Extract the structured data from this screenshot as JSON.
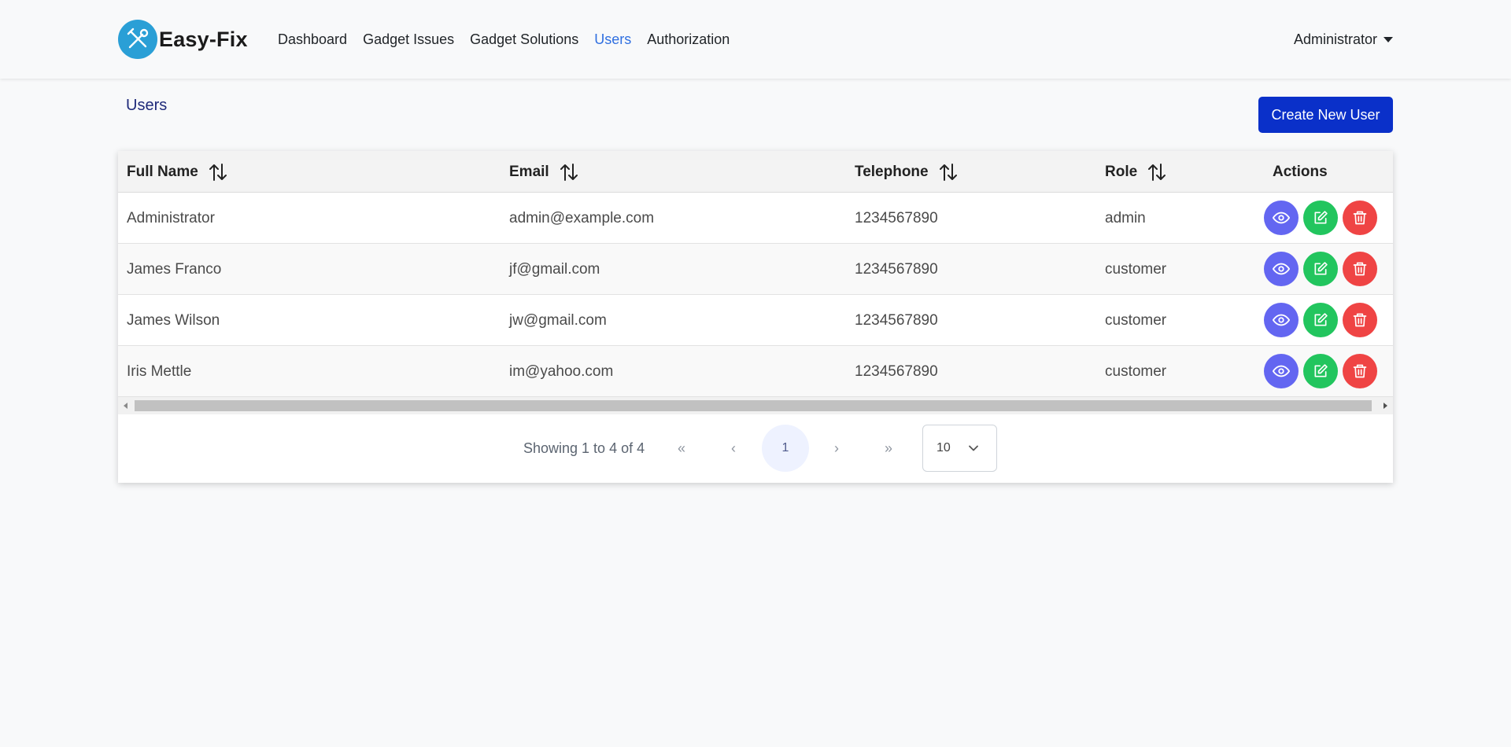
{
  "navbar": {
    "brand": "Easy-Fix",
    "links": [
      {
        "label": "Dashboard",
        "active": false
      },
      {
        "label": "Gadget Issues",
        "active": false
      },
      {
        "label": "Gadget Solutions",
        "active": false
      },
      {
        "label": "Users",
        "active": true
      },
      {
        "label": "Authorization",
        "active": false
      }
    ],
    "user_menu": "Administrator"
  },
  "page": {
    "title": "Users",
    "create_button": "Create New User"
  },
  "table": {
    "columns": [
      "Full Name",
      "Email",
      "Telephone",
      "Role",
      "Actions"
    ],
    "rows": [
      {
        "name": "Administrator",
        "email": "admin@example.com",
        "telephone": "1234567890",
        "role": "admin"
      },
      {
        "name": "James Franco",
        "email": "jf@gmail.com",
        "telephone": "1234567890",
        "role": "customer"
      },
      {
        "name": "James Wilson",
        "email": "jw@gmail.com",
        "telephone": "1234567890",
        "role": "customer"
      },
      {
        "name": "Iris Mettle",
        "email": "im@yahoo.com",
        "telephone": "1234567890",
        "role": "customer"
      }
    ],
    "action_icons": [
      "eye-icon",
      "edit-icon",
      "trash-icon"
    ]
  },
  "paginator": {
    "info": "Showing 1 to 4 of 4",
    "first": "«",
    "prev": "‹",
    "current_page": "1",
    "next": "›",
    "last": "»",
    "rows_per_page": "10"
  },
  "colors": {
    "accent": "#0a30c9",
    "active_link": "#2f6fe0",
    "view": "#6366f1",
    "edit": "#22c55e",
    "delete": "#ef4444",
    "brand_logo": "#2a9fd6"
  }
}
